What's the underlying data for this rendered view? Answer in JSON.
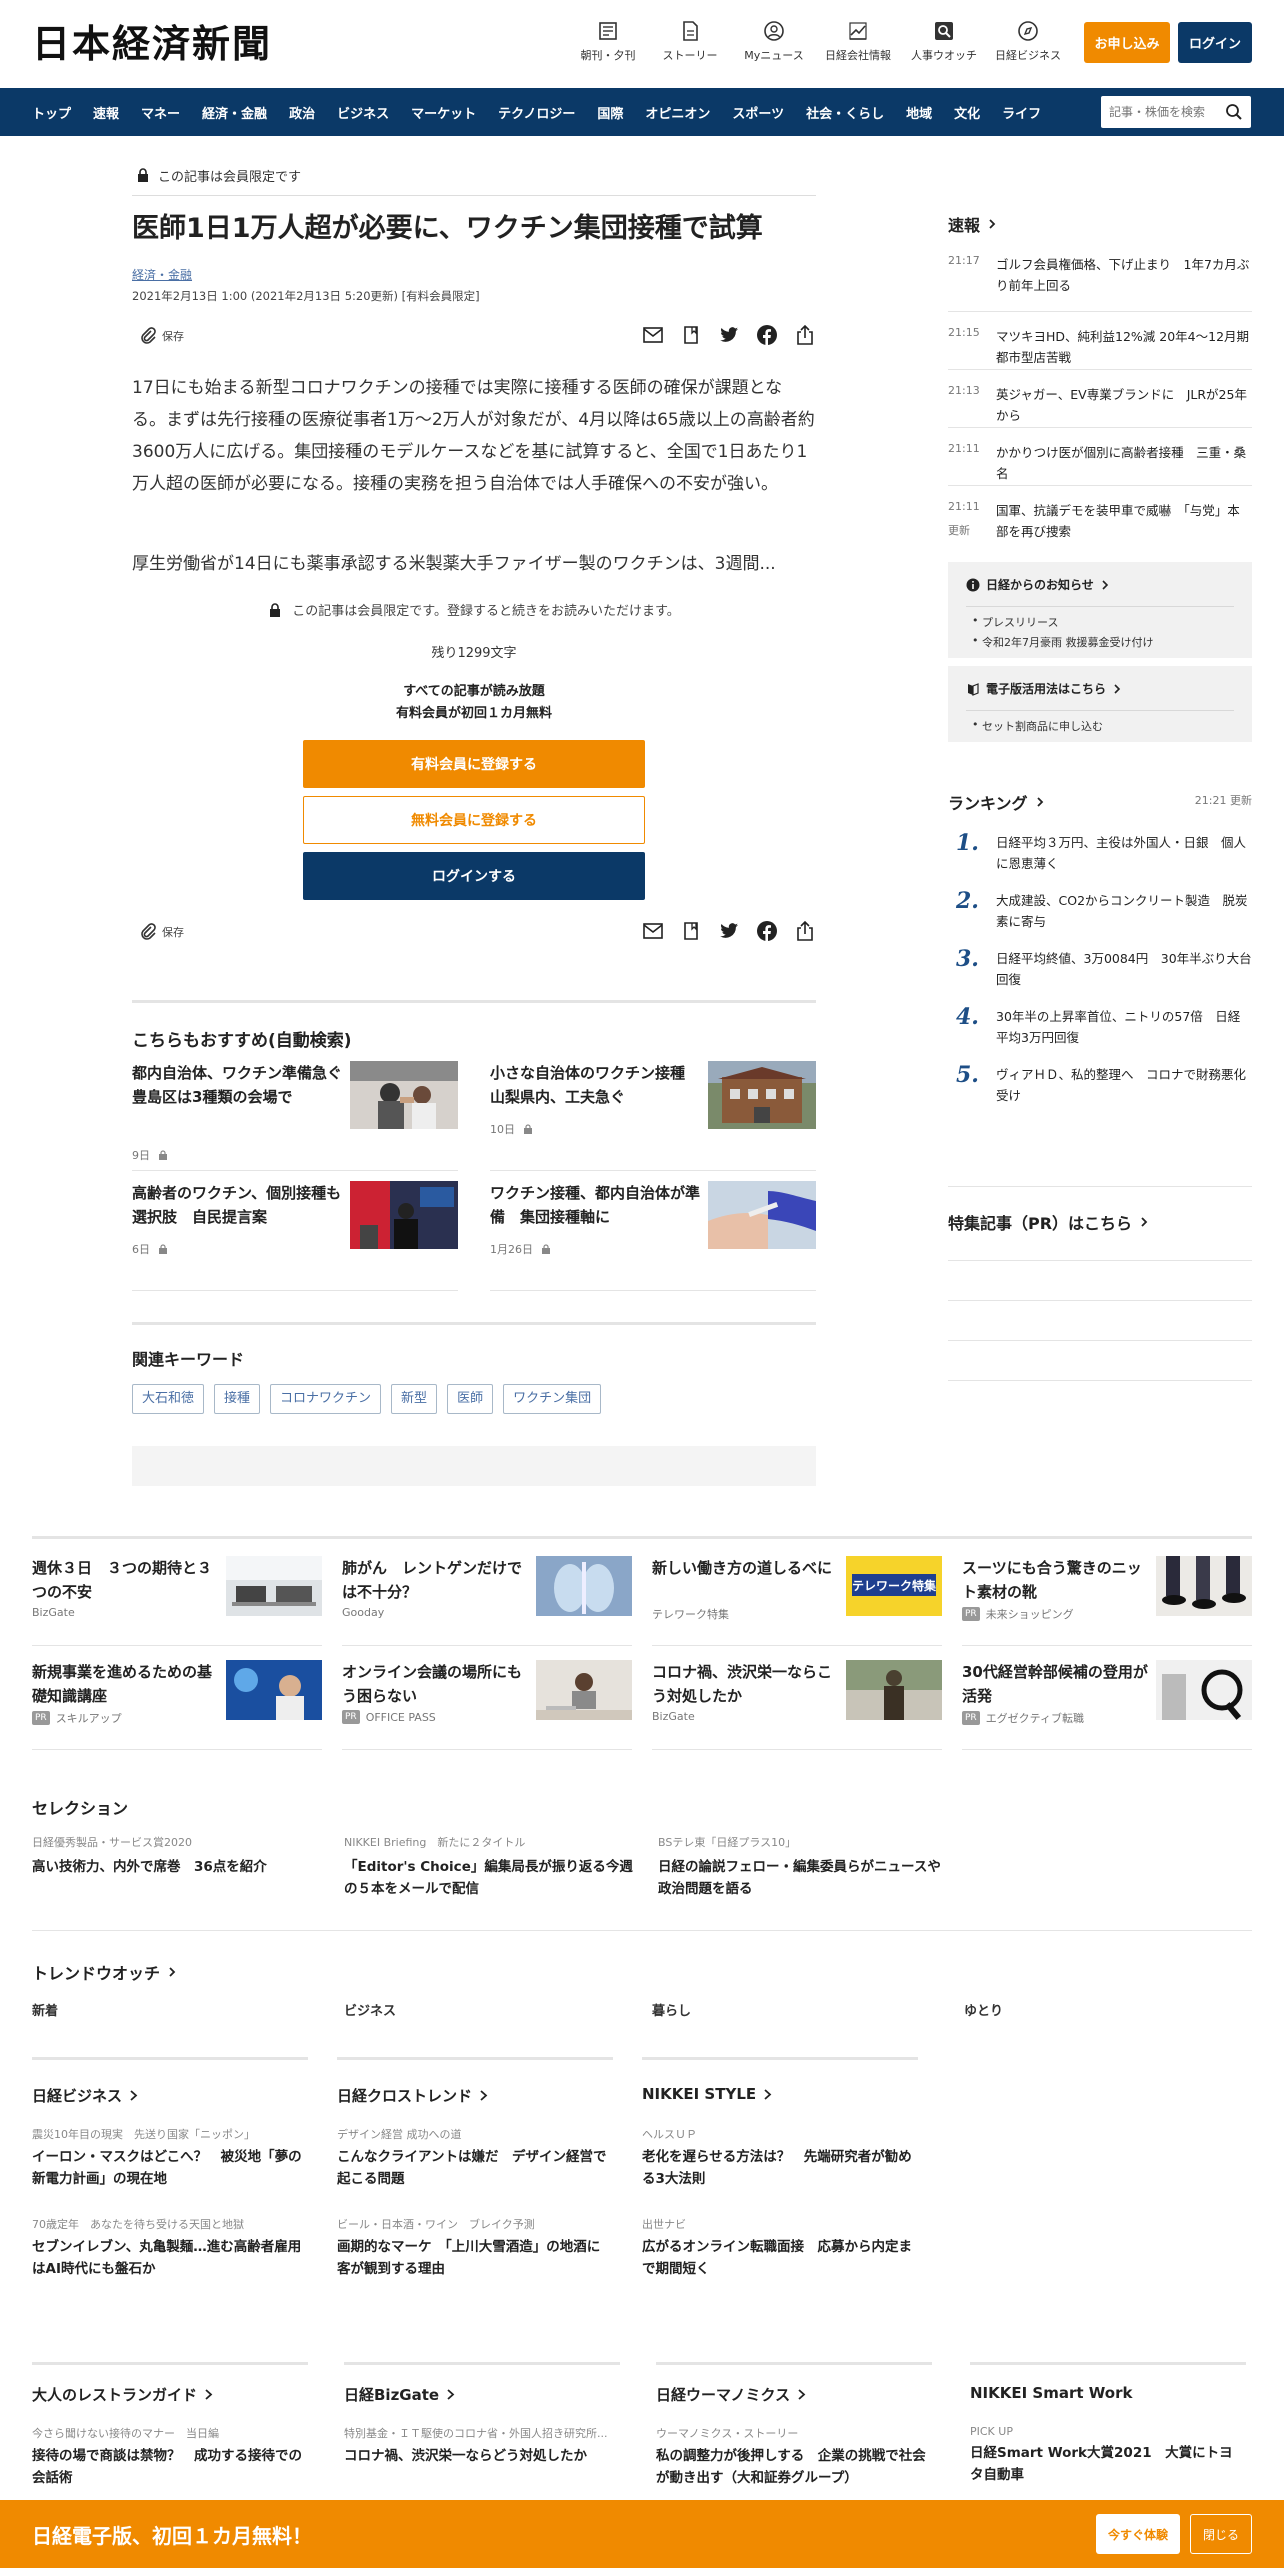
{
  "header": {
    "logo": "日本経済新聞",
    "nav": [
      "朝刊・夕刊",
      "ストーリー",
      "Myニュース",
      "日経会社情報",
      "人事ウオッチ",
      "日経ビジネス"
    ],
    "subscribe_label": "お申し込み",
    "login_label": "ログイン"
  },
  "gnav": {
    "items": [
      "トップ",
      "速報",
      "マネー",
      "経済・金融",
      "政治",
      "ビジネス",
      "マーケット",
      "テクノロジー",
      "国際",
      "オピニオン",
      "スポーツ",
      "社会・くらし",
      "地域",
      "文化",
      "ライフ"
    ],
    "search_placeholder": "記事・株価を検索"
  },
  "article": {
    "member_flag": "この記事は会員限定です",
    "title": "医師1日1万人超が必要に、ワクチン集団接種で試算",
    "category": "経済・金融",
    "date": "2021年2月13日 1:00 (2021年2月13日 5:20更新) [有料会員限定]",
    "save_label": "保存",
    "lead": "17日にも始まる新型コロナワクチンの接種では実際に接種する医師の確保が課題となる。まずは先行接種の医療従事者1万～2万人が対象だが、4月以降は65歳以上の高齢者約3600万人に広げる。集団接種のモデルケースなどを基に試算すると、全国で1日あたり1万人超の医師が必要になる。接種の実務を担う自治体では人手確保への不安が強い。",
    "lead2": "厚生労働省が14日にも薬事承認する米製薬大手ファイザー製のワクチンは、3週間...",
    "lock_note": "この記事は会員限定です。登録すると続きをお読みいただけます。",
    "remain": "残り1299文字",
    "promo_line1": "すべての記事が読み放題",
    "promo_line2": "有料会員が初回１カ月無料",
    "cta_paid": "有料会員に登録する",
    "cta_free": "無料会員に登録する",
    "cta_login": "ログインする"
  },
  "recommend": {
    "title": "こちらもおすすめ(自動検索)",
    "items": [
      {
        "title": "都内自治体、ワクチン準備急ぐ　豊島区は3種類の会場で",
        "date": "9日"
      },
      {
        "title": "小さな自治体のワクチン接種　山梨県内、工夫急ぐ",
        "date": "10日"
      },
      {
        "title": "高齢者のワクチン、個別接種も選択肢　自民提言案",
        "date": "6日"
      },
      {
        "title": "ワクチン接種、都内自治体が準備　集団接種軸に",
        "date": "1月26日"
      }
    ]
  },
  "keywords": {
    "title": "関連キーワード",
    "items": [
      "大石和徳",
      "接種",
      "コロナワクチン",
      "新型",
      "医師",
      "ワクチン集団"
    ]
  },
  "sidebar": {
    "sokuho_title": "速報",
    "sokuho": [
      {
        "time": "21:17",
        "text": "ゴルフ会員権価格、下げ止まり　1年7カ月ぶり前年上回る",
        "updated": ""
      },
      {
        "time": "21:15",
        "text": "マツキヨHD、純利益12%減 20年4～12月期 都市型店苦戦",
        "updated": ""
      },
      {
        "time": "21:13",
        "text": "英ジャガー、EV専業ブランドに　JLRが25年から",
        "updated": ""
      },
      {
        "time": "21:11",
        "text": "かかりつけ医が個別に高齢者接種　三重・桑名",
        "updated": ""
      },
      {
        "time": "21:11",
        "text": "国軍、抗議デモを装甲車で威嚇　「与党」本部を再び捜索",
        "updated": "更新"
      }
    ],
    "info_title": "日経からのお知らせ",
    "info_items": [
      "プレスリリース",
      "令和2年7月豪雨 救援募金受け付け"
    ],
    "epaper_title": "電子版活用法はこちら",
    "epaper_items": [
      "セット割商品に申し込む"
    ],
    "ranking_title": "ランキング",
    "ranking_time": "21:21 更新",
    "ranking": [
      {
        "n": "1.",
        "text": "日経平均３万円、主役は外国人・日銀　個人に恩恵薄く"
      },
      {
        "n": "2.",
        "text": "大成建設、CO2からコンクリート製造　脱炭素に寄与"
      },
      {
        "n": "3.",
        "text": "日経平均終値、3万0084円　30年半ぶり大台回復"
      },
      {
        "n": "4.",
        "text": "30年半の上昇率首位、ニトリの57倍　日経平均3万円回復"
      },
      {
        "n": "5.",
        "text": "ヴィアＨＤ、私的整理へ　コロナで財務悪化受け"
      }
    ],
    "pr_title": "特集記事（PR）はこちら"
  },
  "ads": [
    {
      "title": "週休３日　３つの期待と３つの不安",
      "source": "BizGate",
      "pr": false
    },
    {
      "title": "肺がん　レントゲンだけでは不十分？",
      "source": "Gooday",
      "pr": false
    },
    {
      "title": "新しい働き方の道しるべに",
      "source": "テレワーク特集",
      "pr": false
    },
    {
      "title": "スーツにも合う驚きのニット素材の靴",
      "source": "未来ショッピング",
      "pr": true
    },
    {
      "title": "新規事業を進めるための基礎知識講座",
      "source": "スキルアップ",
      "pr": true
    },
    {
      "title": "オンライン会議の場所にもう困らない",
      "source": "OFFICE PASS",
      "pr": true
    },
    {
      "title": "コロナ禍、渋沢栄一ならこう対処したか",
      "source": "BizGate",
      "pr": false
    },
    {
      "title": "30代経営幹部候補の登用が活発",
      "source": "エグゼクティブ転職",
      "pr": true
    }
  ],
  "ad_image_text": "テレワーク特集",
  "pr_badge": "PR",
  "selection": {
    "title": "セレクション",
    "items": [
      {
        "kicker": "日経優秀製品・サービス賞2020",
        "title": "高い技術力、内外で席巻　36点を紹介"
      },
      {
        "kicker": "NIKKEI Briefing　新たに２タイトル",
        "title": "「Editor's Choice」編集局長が振り返る今週の５本をメールで配信"
      },
      {
        "kicker": "BSテレ東「日経プラス10」",
        "title": "日経の論説フェロー・編集委員らがニュースや政治問題を語る"
      }
    ]
  },
  "trend": {
    "title": "トレンドウオッチ",
    "tabs": [
      "新着",
      "ビジネス",
      "暮らし",
      "ゆとり"
    ]
  },
  "media": [
    {
      "name": "日経ビジネス",
      "items": [
        {
          "kicker": "震災10年目の現実　先送り国家「ニッポン」",
          "title": "イーロン・マスクはどこへ？　被災地「夢の新電力計画」の現在地"
        },
        {
          "kicker": "70歳定年　あなたを待ち受ける天国と地獄",
          "title": "セブンイレブン、丸亀製麺…進む高齢者雇用はAI時代にも盤石か"
        }
      ]
    },
    {
      "name": "日経クロストレンド",
      "items": [
        {
          "kicker": "デザイン経営 成功への道",
          "title": "こんなクライアントは嫌だ　デザイン経営で起こる問題"
        },
        {
          "kicker": "ビール・日本酒・ワイン　ブレイク予測",
          "title": "画期的なマーケ　「上川大雪酒造」の地酒に客が観到する理由"
        }
      ]
    },
    {
      "name": "NIKKEI STYLE",
      "items": [
        {
          "kicker": "ヘルスＵＰ",
          "title": "老化を遅らせる方法は？　先端研究者が勧める3大法則"
        },
        {
          "kicker": "出世ナビ",
          "title": "広がるオンライン転職面接　応募から内定まで期間短く"
        }
      ]
    }
  ],
  "bottom": [
    {
      "name": "大人のレストランガイド",
      "kicker": "今さら聞けない接待のマナー　当日編",
      "title": "接待の場で商談は禁物？　成功する接待での会話術"
    },
    {
      "name": "日経BizGate",
      "kicker": "特別基金・ＩＴ駆使のコロナ省・外国人招き研究所...",
      "title": "コロナ禍、渋沢栄一ならどう対処したか"
    },
    {
      "name": "日経ウーマノミクス",
      "kicker": "ウーマノミクス・ストーリー",
      "title": "私の調整力が後押しする　企業の挑戦で社会が動き出す（大和証券グループ）"
    },
    {
      "name": "NIKKEI Smart Work",
      "kicker": "PICK UP",
      "title": "日経Smart Work大賞2021　大賞にトヨタ自動車"
    }
  ],
  "banner": {
    "text": "日経電子版、初回１カ月無料！",
    "try_label": "今すぐ体験",
    "close_label": "閉じる"
  },
  "colors": {
    "navy": "#0b3967",
    "orange": "#f08a00",
    "link": "#4a6fa5"
  }
}
